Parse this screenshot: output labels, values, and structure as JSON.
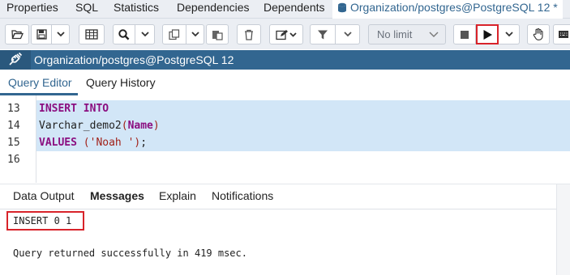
{
  "top_tabs": {
    "items": [
      "Properties",
      "SQL",
      "Statistics",
      "Dependencies",
      "Dependents"
    ],
    "active_tab": "Organization/postgres@PostgreSQL 12 *"
  },
  "toolbar": {
    "limit_label": "No limit",
    "icons": [
      "open-folder-icon",
      "save-icon",
      "chevron-down-icon",
      "grid-icon",
      "search-icon",
      "copy-icon",
      "paste-icon",
      "delete-icon",
      "edit-icon",
      "filter-icon",
      "stop-icon",
      "execute-icon",
      "hand-icon",
      "keyboard-icon"
    ]
  },
  "connection": {
    "label": "Organization/postgres@PostgreSQL 12"
  },
  "editor_tabs": [
    "Query Editor",
    "Query History"
  ],
  "editor": {
    "lines": [
      {
        "num": "13",
        "kw1": "INSERT INTO",
        "plain1": "",
        "kw2": "",
        "plain2": "",
        "str": ""
      },
      {
        "num": "14",
        "kw1": "",
        "plain1": "Varchar_demo2",
        "paren_open": "(",
        "kw2": "Name",
        "paren_close": ")"
      },
      {
        "num": "15",
        "kw1": "VALUES",
        "paren_open": "(",
        "str": "'Noah '",
        "paren_close": ")",
        "tail": ";"
      },
      {
        "num": "16"
      }
    ]
  },
  "results": {
    "tabs": [
      "Data Output",
      "Messages",
      "Explain",
      "Notifications"
    ],
    "active_tab": "Messages",
    "message_status": "INSERT 0 1",
    "message_detail": "Query returned successfully in 419 msec."
  },
  "colors": {
    "accent": "#326690",
    "highlight": "#d8232a",
    "selection": "#d2e6f7",
    "keyword": "#8b0f80"
  }
}
